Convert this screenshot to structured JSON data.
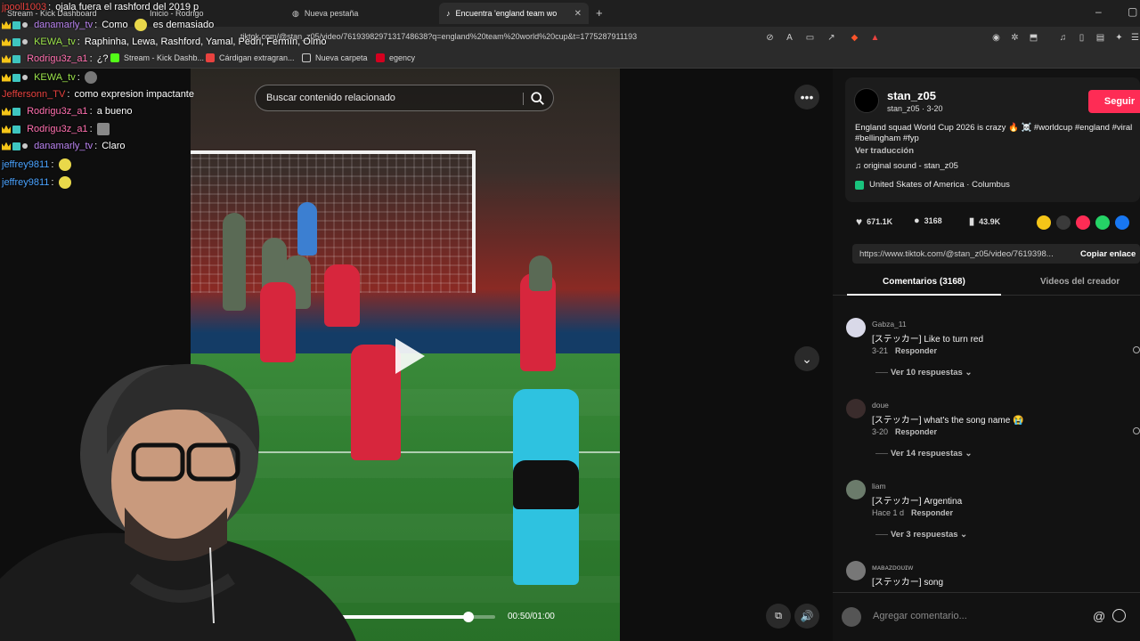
{
  "browser": {
    "tabs": [
      {
        "label": "Stream - Kick Dashboard"
      },
      {
        "label": "Inicio - Rodrigo"
      },
      {
        "label": "Nueva pestaña"
      },
      {
        "label": "Encuentra 'england team wo"
      }
    ],
    "url": "tiktok.com/@stan_z05/video/7619398297131748638?q=england%20team%20world%20cup&t=1775287911193",
    "bookmarks": [
      "Stream - Kick Dashb...",
      "Cárdigan extragran...",
      "Nueva carpeta",
      "egency"
    ]
  },
  "chat": [
    {
      "user": "jpooll1003",
      "message": "ojala fuera el rashford del 2019 p",
      "user_color": "#e8423f"
    },
    {
      "user": "danamarly_tv",
      "message": "Como",
      "message2": "es demasiado",
      "user_color": "#b983f0"
    },
    {
      "user": "KEWA_tv",
      "message": "Raphinha, Lewa, Rashford, Yamal, Pedri, Fermín, Olmo",
      "user_color": "#9be34a"
    },
    {
      "user": "Rodrigu3z_a1",
      "message": "¿?",
      "user_color": "#ff6fae"
    },
    {
      "user": "KEWA_tv",
      "message": "",
      "user_color": "#9be34a"
    },
    {
      "user": "Jeffersonn_TV",
      "message": "como expresion impactante",
      "user_color": "#e8423f"
    },
    {
      "user": "Rodrigu3z_a1",
      "message": "a bueno",
      "user_color": "#ff6fae"
    },
    {
      "user": "Rodrigu3z_a1",
      "message": "",
      "user_color": "#ff6fae"
    },
    {
      "user": "danamarly_tv",
      "message": "Claro",
      "user_color": "#b983f0"
    },
    {
      "user": "jeffrey9811",
      "message": "",
      "user_color": "#4aa3ff"
    },
    {
      "user": "jeffrey9811",
      "message": "",
      "user_color": "#4aa3ff"
    }
  ],
  "video": {
    "search_placeholder": "Buscar contenido relacionado",
    "timecode": "00:50/01:00",
    "progress": 0.83
  },
  "panel": {
    "username": "stan_z05",
    "subline": "stan_z05 · 3-20",
    "follow_label": "Seguir",
    "description": "England squad World Cup 2026 is crazy 🔥 ☠️ #worldcup #england #viral #bellingham #fyp",
    "translate_label": "Ver traducción",
    "sound": "♫  original sound - stan_z05",
    "location": "United Skates of America · Columbus",
    "likes": "671.1K",
    "comments": "3168",
    "saves": "43.9K",
    "link": "https://www.tiktok.com/@stan_z05/video/7619398...",
    "copy_label": "Copiar enlace",
    "tab_comments": "Comentarios (3168)",
    "tab_videos": "Videos del creador",
    "comment_placeholder": "Agregar comentario..."
  },
  "comments": [
    {
      "user": "Gabza_11",
      "text": "[ステッカー] Like to turn red",
      "date": "3-21",
      "reply": "Responder",
      "replies": "Ver 10 respuestas"
    },
    {
      "user": "doue",
      "text": "[ステッカー] what's the song name 😭",
      "date": "3-20",
      "reply": "Responder",
      "replies": "Ver 14 respuestas"
    },
    {
      "user": "liam",
      "text": "[ステッカー] Argentina",
      "date": "Hace 1 d",
      "reply": "Responder",
      "replies": "Ver 3 respuestas"
    },
    {
      "user": "ᴍᴀʙᴀᴢᴅᴏᴜɪᴡ",
      "text": "[ステッカー] song",
      "date": "",
      "reply": "",
      "replies": ""
    }
  ],
  "colors": {
    "accent": "#fe2c55",
    "panel_bg": "#121212",
    "card_bg": "#1c1c1c"
  }
}
